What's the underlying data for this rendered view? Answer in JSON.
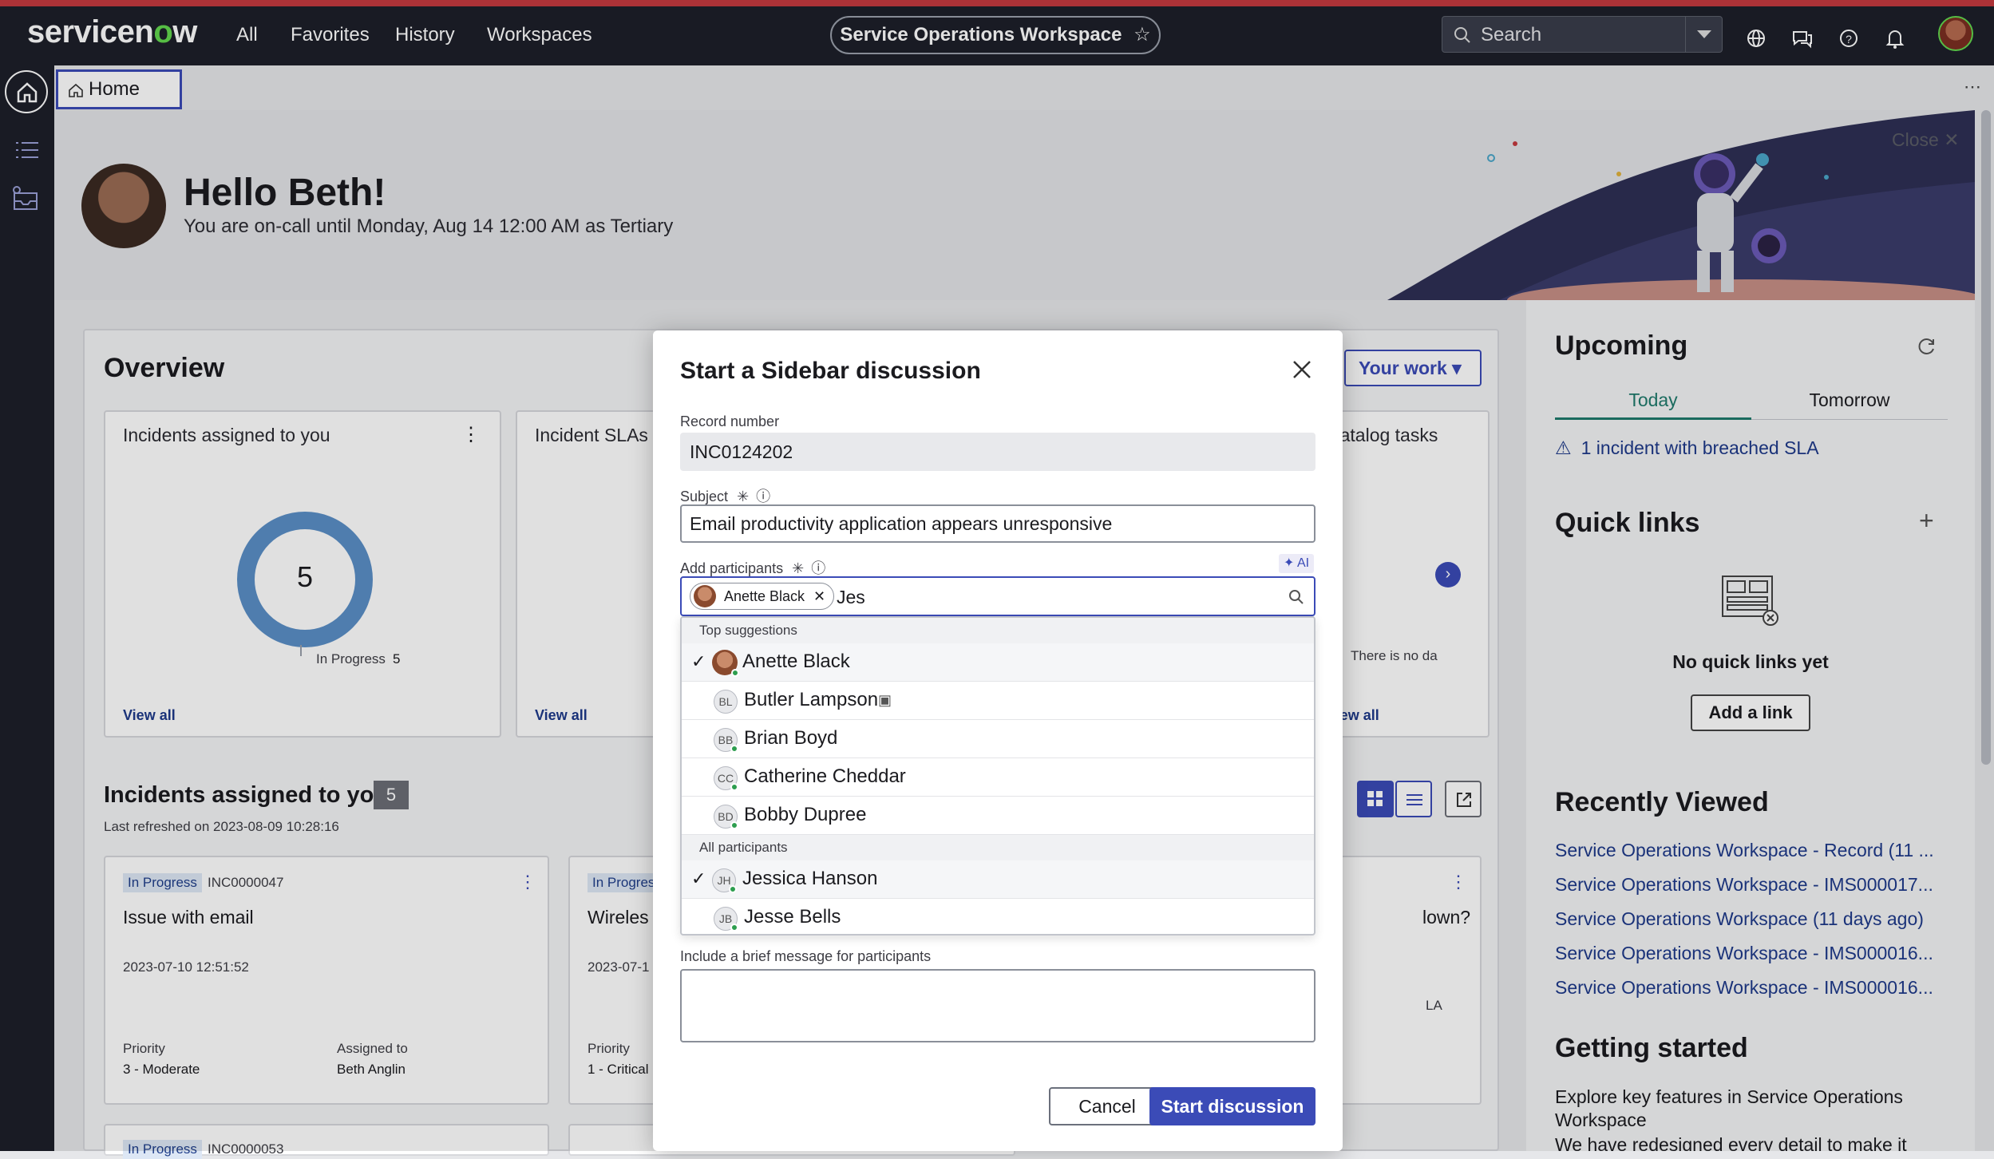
{
  "topnav": {
    "logo": "servicenow",
    "links": [
      "All",
      "Favorites",
      "History",
      "Workspaces"
    ],
    "workspace_title": "Service Operations Workspace",
    "search_placeholder": "Search"
  },
  "tabs": {
    "home": "Home"
  },
  "greeting": {
    "title": "Hello Beth!",
    "subtitle": "You are on-call until Monday, Aug 14 12:00 AM as Tertiary",
    "close_label": "Close"
  },
  "overview": {
    "title": "Overview",
    "your_work_label": "Your work",
    "cards": [
      {
        "title": "Incidents assigned to you",
        "donut_value": "5",
        "legend": "In Progress",
        "legend_count": "5",
        "view_all": "View all"
      },
      {
        "title": "Incident SLAs",
        "view_all": "View all"
      },
      {
        "title": "Catalog tasks",
        "empty_text": "There is no da",
        "view_all": "View all"
      }
    ]
  },
  "incidents_section": {
    "title": "Incidents assigned to you",
    "count": "5",
    "refreshed": "Last refreshed on 2023-08-09 10:28:16",
    "cards": [
      {
        "status": "In Progress",
        "number": "INC0000047",
        "title": "Issue with email",
        "date": "2023-07-10 12:51:52",
        "priority_label": "Priority",
        "priority": "3 - Moderate",
        "assigned_label": "Assigned to",
        "assigned": "Beth Anglin"
      },
      {
        "status": "In Progres",
        "title": "Wireles",
        "date": "2023-07-1",
        "priority_label": "Priority",
        "priority": "1 - Critical"
      },
      {
        "title": "lown?",
        "extra": "LA"
      }
    ],
    "row2_status": "In Progress",
    "row2_number": "INC0000053"
  },
  "upcoming": {
    "title": "Upcoming",
    "tabs": [
      "Today",
      "Tomorrow"
    ],
    "alert": "1 incident with breached SLA"
  },
  "quick_links": {
    "title": "Quick links",
    "empty": "No quick links yet",
    "add_button": "Add a link"
  },
  "recently_viewed": {
    "title": "Recently Viewed",
    "items": [
      "Service Operations Workspace - Record (11 ...",
      "Service Operations Workspace - IMS000017...",
      "Service Operations Workspace (11 days ago)",
      "Service Operations Workspace - IMS000016...",
      "Service Operations Workspace - IMS000016..."
    ]
  },
  "getting_started": {
    "title": "Getting started",
    "text": "Explore key features in Service Operations Workspace",
    "text2": "We have redesigned every detail to make it"
  },
  "modal": {
    "title": "Start a Sidebar discussion",
    "record_label": "Record number",
    "record_value": "INC0124202",
    "subject_label": "Subject",
    "subject_value": "Email productivity application appears unresponsive",
    "participants_label": "Add participants",
    "ai_badge": "AI",
    "chip": "Anette Black",
    "query": "Jes",
    "top_suggestions_label": "Top suggestions",
    "top_suggestions": [
      {
        "name": "Anette Black",
        "initials": "",
        "selected": true
      },
      {
        "name": "Butler Lampson",
        "initials": "BL",
        "selected": false
      },
      {
        "name": "Brian Boyd",
        "initials": "BB",
        "selected": false
      },
      {
        "name": "Catherine Cheddar",
        "initials": "CC",
        "selected": false
      },
      {
        "name": "Bobby Dupree",
        "initials": "BD",
        "selected": false
      }
    ],
    "all_participants_label": "All participants",
    "all_participants": [
      {
        "name": "Jessica Hanson",
        "initials": "JH",
        "selected": true
      },
      {
        "name": "Jesse Bells",
        "initials": "JB",
        "selected": false
      }
    ],
    "message_label": "Include a brief message for participants",
    "cancel": "Cancel",
    "start": "Start discussion"
  },
  "colors": {
    "accent": "#3b4bb7",
    "nav_bg": "#1d1f29",
    "top_stripe": "#c43a3f",
    "donut": "#5b8fc7"
  }
}
